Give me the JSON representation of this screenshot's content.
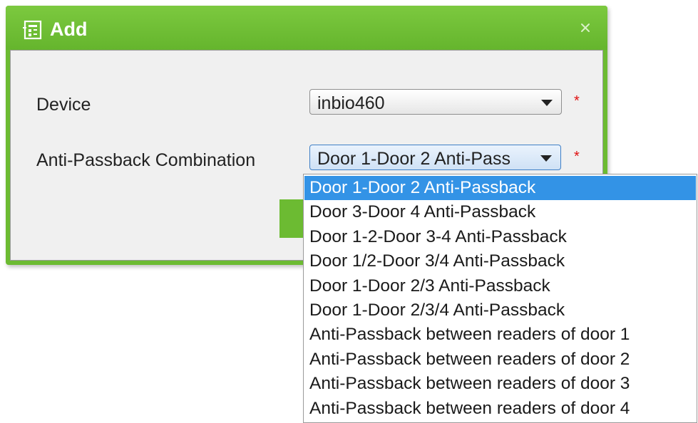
{
  "dialog": {
    "title": "Add",
    "title_icon": "form-add-icon",
    "close_icon": "close-icon"
  },
  "form": {
    "device": {
      "label": "Device",
      "value": "inbio460",
      "required_mark": "*"
    },
    "combination": {
      "label": "Anti-Passback Combination",
      "value": "Door 1-Door 2 Anti-Pass",
      "required_mark": "*"
    }
  },
  "dropdown": {
    "options": [
      "Door 1-Door 2 Anti-Passback",
      "Door 3-Door 4 Anti-Passback",
      "Door 1-2-Door 3-4 Anti-Passback",
      "Door 1/2-Door 3/4 Anti-Passback",
      "Door 1-Door 2/3 Anti-Passback",
      "Door 1-Door 2/3/4 Anti-Passback",
      "Anti-Passback between readers of door 1",
      "Anti-Passback between readers of door 2",
      "Anti-Passback between readers of door 3",
      "Anti-Passback between readers of door 4"
    ],
    "selected_index": 0
  },
  "colors": {
    "accent": "#6cbb32",
    "selection": "#3393e6",
    "required": "#e01010"
  }
}
